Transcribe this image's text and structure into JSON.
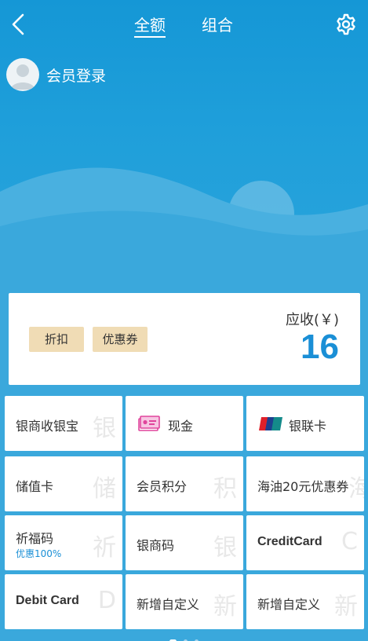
{
  "header": {
    "tabs": [
      {
        "label": "全额",
        "active": true
      },
      {
        "label": "组合",
        "active": false
      }
    ]
  },
  "member": {
    "label": "会员登录"
  },
  "amount": {
    "chips": [
      "折扣",
      "优惠券"
    ],
    "receivable_label": "应收(￥)",
    "receivable_value": "16"
  },
  "payment_methods": [
    {
      "label": "银商收银宝",
      "watermark": "银"
    },
    {
      "label": "现金",
      "icon": "cash-icon"
    },
    {
      "label": "银联卡",
      "icon": "unionpay-icon"
    },
    {
      "label": "储值卡",
      "watermark": "储"
    },
    {
      "label": "会员积分",
      "watermark": "积"
    },
    {
      "label": "海油20元优惠券",
      "watermark": "海"
    },
    {
      "label": "祈福码",
      "sub": "优惠100%",
      "watermark": "祈"
    },
    {
      "label": "银商码",
      "watermark": "银"
    },
    {
      "label": "CreditCard",
      "watermark": "C"
    },
    {
      "label": "Debit Card",
      "watermark": "D"
    },
    {
      "label": "新增自定义",
      "watermark": "新"
    },
    {
      "label": "新增自定义",
      "watermark": "新"
    }
  ],
  "pager": {
    "pages": 3,
    "current": 1
  },
  "colors": {
    "accent": "#1a8fd6",
    "chip": "#f0dcb5",
    "background": "#3aa8dc"
  }
}
